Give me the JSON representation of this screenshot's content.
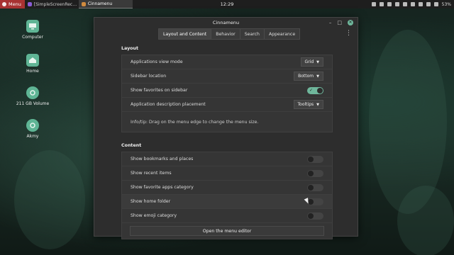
{
  "panel": {
    "menu_label": "Menu",
    "tasks": [
      {
        "label": "[SimpleScreenRec…",
        "color": "#8a5cd6"
      },
      {
        "label": "Cinnamenu",
        "color": "#d08b3f"
      }
    ],
    "clock": "12:29",
    "battery": "53%"
  },
  "desktop": {
    "icons": [
      {
        "label": "Computer",
        "icon": "computer-icon",
        "color": "#5fb595"
      },
      {
        "label": "Home",
        "icon": "home-folder-icon",
        "color": "#5fb595"
      },
      {
        "label": "211 GB Volume",
        "icon": "drive-icon",
        "color": "#5fb595"
      },
      {
        "label": "Akmy",
        "icon": "drive-icon",
        "color": "#5fb595"
      }
    ]
  },
  "window": {
    "title": "Cinnamenu",
    "tabs": [
      "Layout and Content",
      "Behavior",
      "Search",
      "Appearance"
    ],
    "active_tab": "Layout and Content",
    "layout": {
      "title": "Layout",
      "rows": [
        {
          "label": "Applications view mode",
          "value": "Grid"
        },
        {
          "label": "Sidebar location",
          "value": "Bottom"
        },
        {
          "label": "Show favorites on sidebar",
          "toggle": true
        },
        {
          "label": "Application description placement",
          "value": "Tooltips"
        }
      ],
      "info": "Info/tip: Drag on the menu edge to change the menu size."
    },
    "content": {
      "title": "Content",
      "rows": [
        {
          "label": "Show bookmarks and places",
          "toggle": false
        },
        {
          "label": "Show recent items",
          "toggle": false
        },
        {
          "label": "Show favorite apps category",
          "toggle": false
        },
        {
          "label": "Show home folder",
          "toggle": false
        },
        {
          "label": "Show emoji category",
          "toggle": false
        }
      ],
      "button": "Open the menu editor"
    }
  },
  "colors": {
    "accent": "#6fb79c",
    "menu_button": "#a83232"
  }
}
